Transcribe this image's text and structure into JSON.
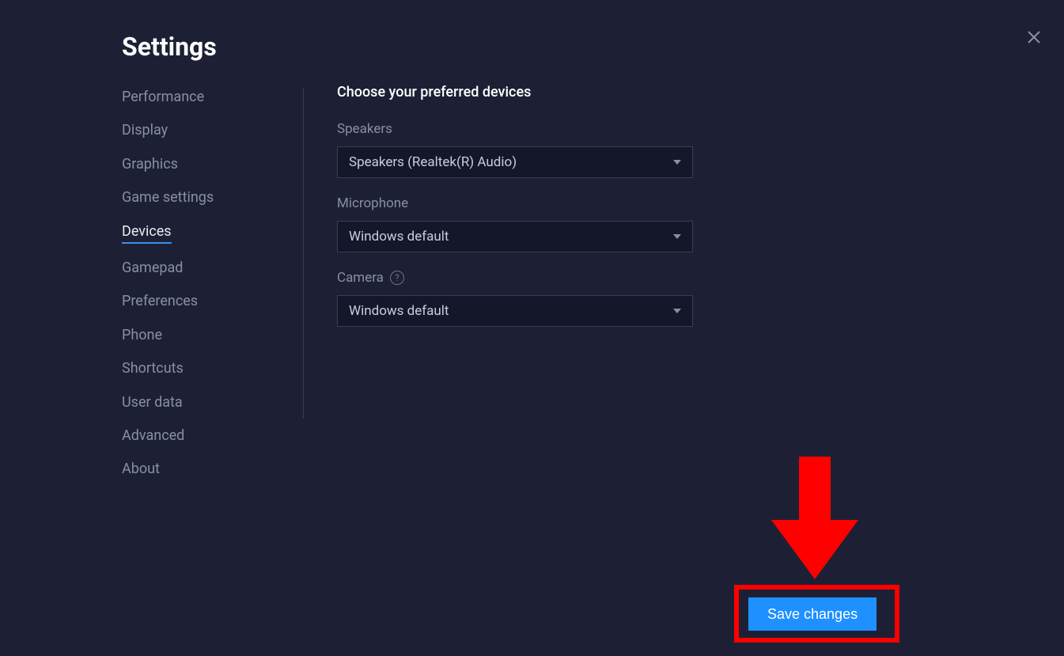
{
  "header": {
    "title": "Settings"
  },
  "sidebar": {
    "items": [
      {
        "label": "Performance",
        "active": false
      },
      {
        "label": "Display",
        "active": false
      },
      {
        "label": "Graphics",
        "active": false
      },
      {
        "label": "Game settings",
        "active": false
      },
      {
        "label": "Devices",
        "active": true
      },
      {
        "label": "Gamepad",
        "active": false
      },
      {
        "label": "Preferences",
        "active": false
      },
      {
        "label": "Phone",
        "active": false
      },
      {
        "label": "Shortcuts",
        "active": false
      },
      {
        "label": "User data",
        "active": false
      },
      {
        "label": "Advanced",
        "active": false
      },
      {
        "label": "About",
        "active": false
      }
    ]
  },
  "main": {
    "heading": "Choose your preferred devices",
    "fields": {
      "speakers": {
        "label": "Speakers",
        "value": "Speakers (Realtek(R) Audio)"
      },
      "microphone": {
        "label": "Microphone",
        "value": "Windows default"
      },
      "camera": {
        "label": "Camera",
        "value": "Windows default",
        "help": "?"
      }
    }
  },
  "footer": {
    "save_label": "Save changes"
  }
}
